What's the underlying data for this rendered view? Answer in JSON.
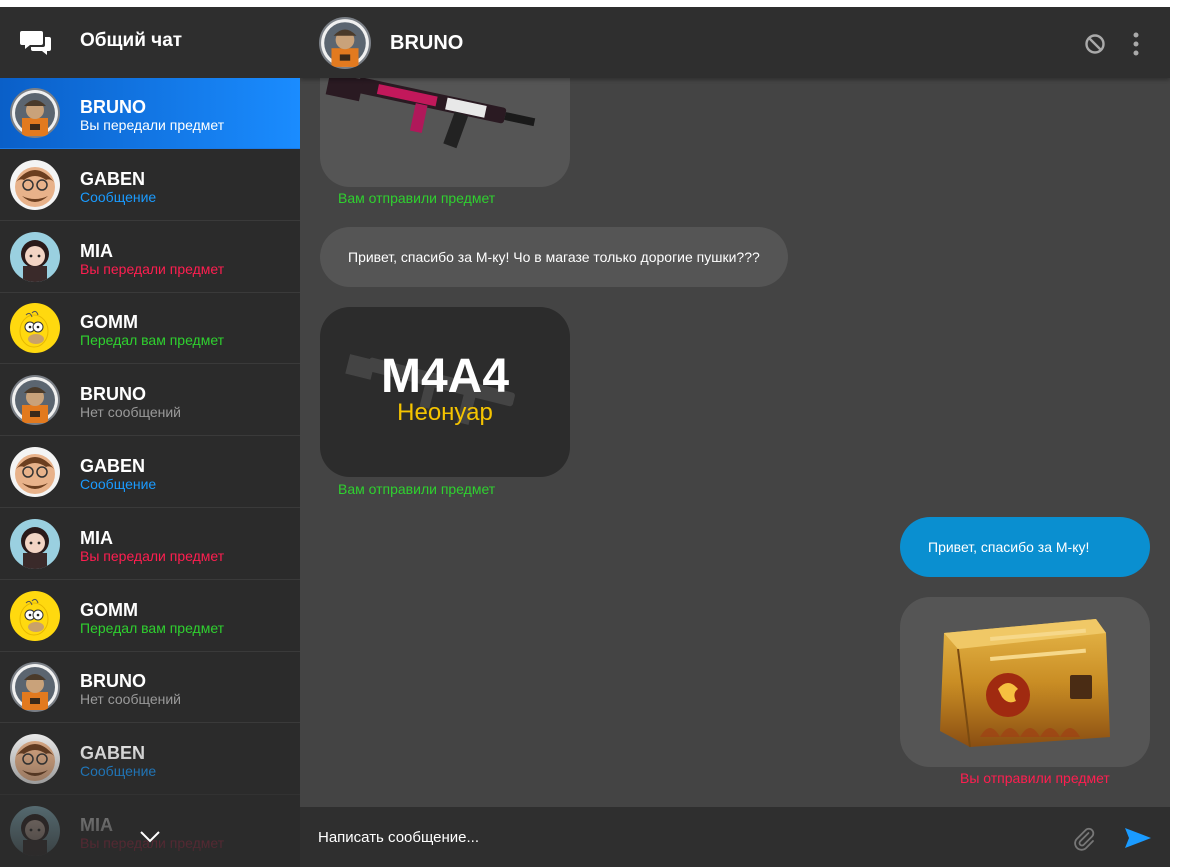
{
  "sidebar": {
    "title": "Общий чат",
    "contacts": [
      {
        "name": "BRUNO",
        "status": "Вы передали предмет",
        "status_color": "#ffffff",
        "avatar": "bruno",
        "active": true
      },
      {
        "name": "GABEN",
        "status": "Сообщение",
        "status_color": "#1a9bff",
        "avatar": "gaben"
      },
      {
        "name": "MIA",
        "status": "Вы передали предмет",
        "status_color": "#ff1e50",
        "avatar": "mia"
      },
      {
        "name": "GOMM",
        "status": "Передал вам предмет",
        "status_color": "#2fd12f",
        "avatar": "gomm"
      },
      {
        "name": "BRUNO",
        "status": "Нет сообщений",
        "status_color": "#9a9a9a",
        "avatar": "bruno"
      },
      {
        "name": "GABEN",
        "status": "Сообщение",
        "status_color": "#1a9bff",
        "avatar": "gaben"
      },
      {
        "name": "MIA",
        "status": "Вы передали предмет",
        "status_color": "#ff1e50",
        "avatar": "mia"
      },
      {
        "name": "GOMM",
        "status": "Передал вам предмет",
        "status_color": "#2fd12f",
        "avatar": "gomm"
      },
      {
        "name": "BRUNO",
        "status": "Нет сообщений",
        "status_color": "#9a9a9a",
        "avatar": "bruno"
      },
      {
        "name": "GABEN",
        "status": "Сообщение",
        "status_color": "#1a9bff",
        "avatar": "gaben"
      },
      {
        "name": "MIA",
        "status": "Вы передали предмет",
        "status_color": "#ff1e50",
        "avatar": "mia"
      }
    ]
  },
  "chat": {
    "contact_name": "BRUNO",
    "messages": [
      {
        "type": "item-in",
        "item": "rifle",
        "caption": "Вам отправили предмет",
        "caption_color": "#2fd12f"
      },
      {
        "type": "text-in",
        "text": "Привет, спасибо за М-ку! Чо в магазе только дорогие пушки???"
      },
      {
        "type": "item-in",
        "item": "M4A4",
        "item_subtitle": "Неонуар",
        "caption": "Вам отправили предмет",
        "caption_color": "#2fd12f"
      },
      {
        "type": "text-out",
        "text": "Привет, спасибо за М-ку!"
      },
      {
        "type": "item-out",
        "item": "case",
        "caption": "Вы отправили предмет",
        "caption_color": "#ff1e50"
      }
    ]
  },
  "composer": {
    "placeholder": "Написать сообщение..."
  },
  "colors": {
    "accent": "#0a8fd0",
    "active_contact": "#1a8cff",
    "received": "#2fd12f",
    "sent": "#ff1e50"
  }
}
